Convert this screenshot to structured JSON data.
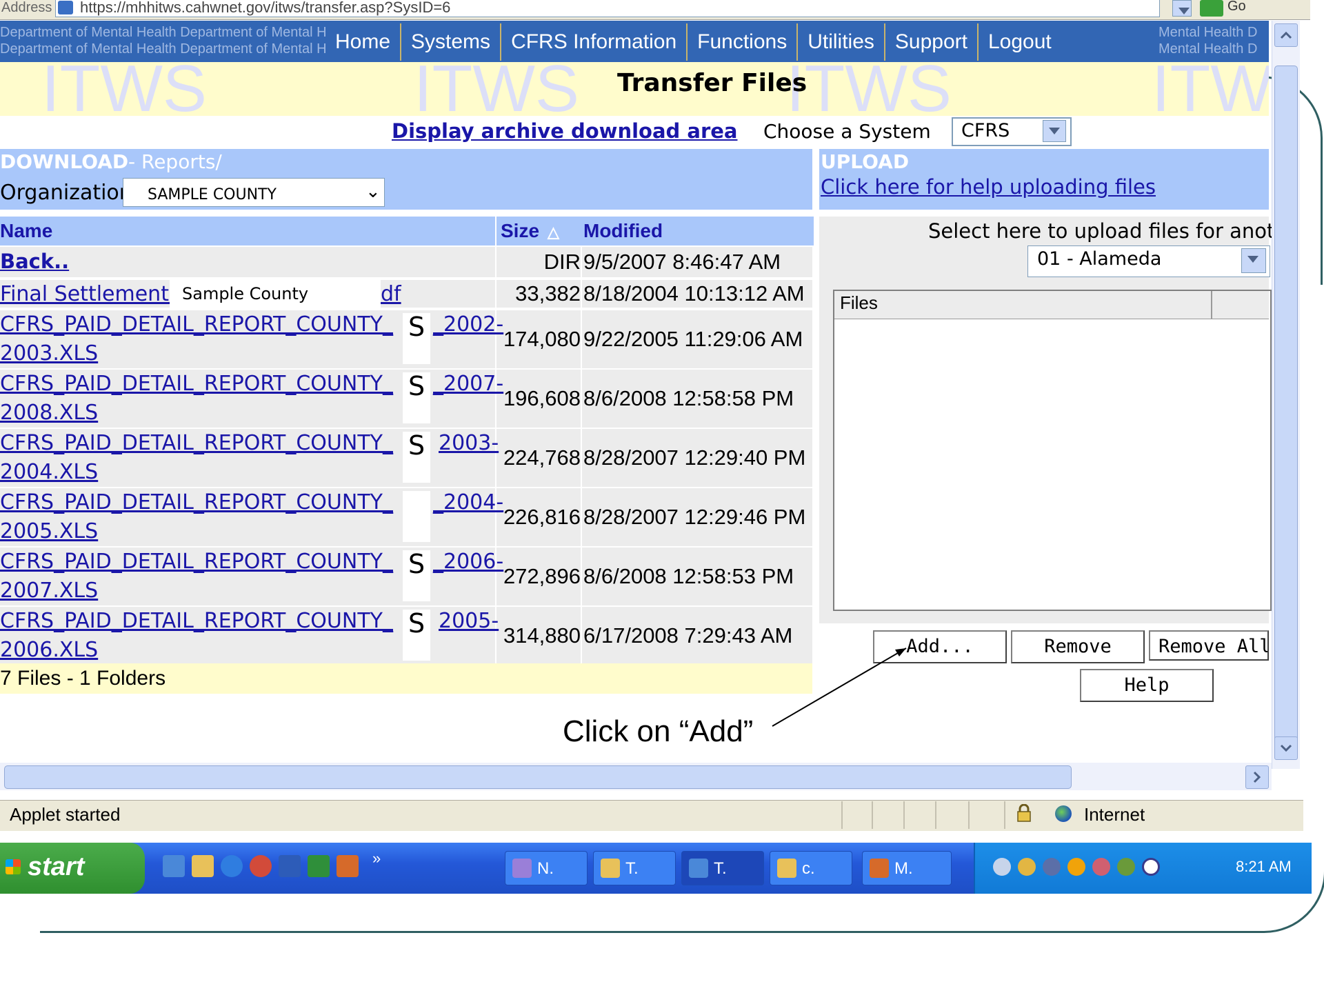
{
  "browser": {
    "address_label": "Address",
    "url": "https://mhhitws.cahwnet.gov/itws/transfer.asp?SysID=6",
    "go_label": "Go"
  },
  "banner": {
    "repeat_text": "Department of Mental Health  Department of Mental Health  Department of Mental Health  Department of Mental Health",
    "right_text": "Mental Health  D"
  },
  "nav": {
    "items": [
      "Home",
      "Systems",
      "CFRS Information",
      "Functions",
      "Utilities",
      "Support",
      "Logout"
    ]
  },
  "watermark": "ITWS",
  "page": {
    "title": "Transfer Files",
    "archive_link": "Display archive download area",
    "choose_label": "Choose a System",
    "system_value": "CFRS"
  },
  "download": {
    "title": "DOWNLOAD",
    "subtitle": "- Reports/",
    "org_label": "Organization",
    "org_value": "SAMPLE COUNTY"
  },
  "upload": {
    "title": "UPLOAD",
    "help_link": "Click here for help uploading files",
    "select_label": "Select here to upload files for anoth",
    "county_value": "01 - Alameda",
    "files_header": "Files",
    "buttons": {
      "add": "Add...",
      "remove": "Remove",
      "remove_all": "Remove All",
      "help": "Help"
    }
  },
  "table": {
    "headers": {
      "name": "Name",
      "size": "Size",
      "modified": "Modified"
    },
    "rows": [
      {
        "name": "Back..",
        "size": "DIR",
        "modified": "9/5/2007 8:46:47 AM"
      },
      {
        "name": "Final Settlement fo",
        "name_tail": "df",
        "overlay": "Sample County",
        "size": "33,382",
        "modified": "8/18/2004 10:13:12 AM"
      },
      {
        "name": "CFRS_PAID_DETAIL_REPORT_COUNTY_",
        "mark": "S",
        "suffix": "_2002-",
        "line2": "2003.XLS",
        "size": "174,080",
        "modified": "9/22/2005 11:29:06 AM"
      },
      {
        "name": "CFRS_PAID_DETAIL_REPORT_COUNTY_",
        "mark": "S",
        "suffix": "_2007-",
        "line2": "2008.XLS",
        "size": "196,608",
        "modified": "8/6/2008 12:58:58 PM"
      },
      {
        "name": "CFRS_PAID_DETAIL_REPORT_COUNTY_",
        "mark": "S",
        "suffix": "2003-",
        "line2": "2004.XLS",
        "size": "224,768",
        "modified": "8/28/2007 12:29:40 PM"
      },
      {
        "name": "CFRS_PAID_DETAIL_REPORT_COUNTY_",
        "mark": "",
        "suffix": "_2004-",
        "line2": "2005.XLS",
        "size": "226,816",
        "modified": "8/28/2007 12:29:46 PM"
      },
      {
        "name": "CFRS_PAID_DETAIL_REPORT_COUNTY_",
        "mark": "S",
        "suffix": "_2006-",
        "line2": "2007.XLS",
        "size": "272,896",
        "modified": "8/6/2008 12:58:53 PM"
      },
      {
        "name": "CFRS_PAID_DETAIL_REPORT_COUNTY_",
        "mark": "S",
        "suffix": "2005-",
        "line2": "2006.XLS",
        "size": "314,880",
        "modified": "6/17/2008 7:29:43 AM"
      }
    ],
    "footer": "7 Files - 1 Folders"
  },
  "callout": "Click on “Add”",
  "status": {
    "text": "Applet started",
    "zone": "Internet"
  },
  "taskbar": {
    "start": "start",
    "tasks": [
      "N.",
      "T.",
      "T.",
      "c.",
      "M."
    ],
    "clock": "8:21 AM"
  }
}
